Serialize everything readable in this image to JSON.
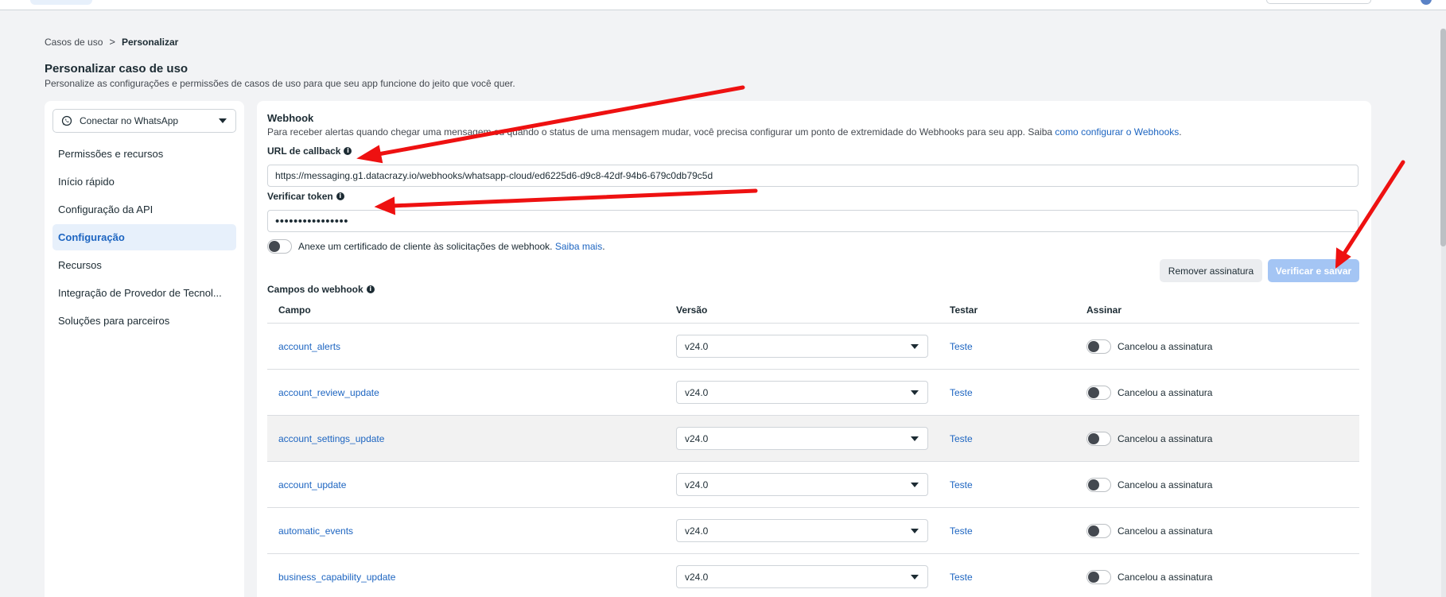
{
  "breadcrumb": {
    "parent": "Casos de uso",
    "separator": ">",
    "current": "Personalizar"
  },
  "header": {
    "title": "Personalizar caso de uso",
    "subtitle": "Personalize as configurações e permissões de casos de uso para que seu app funcione do jeito que você quer."
  },
  "sidebar": {
    "selector": {
      "label": "Conectar no WhatsApp",
      "icon": "whatsapp-icon"
    },
    "items": [
      {
        "label": "Permissões e recursos"
      },
      {
        "label": "Início rápido"
      },
      {
        "label": "Configuração da API"
      },
      {
        "label": "Configuração",
        "active": true
      },
      {
        "label": "Recursos"
      },
      {
        "label": "Integração de Provedor de Tecnol..."
      },
      {
        "label": "Soluções para parceiros"
      }
    ]
  },
  "webhook": {
    "title": "Webhook",
    "description": "Para receber alertas quando chegar uma mensagem ou quando o status de uma mensagem mudar, você precisa configurar um ponto de extremidade do Webhooks para seu app. Saiba",
    "description_link": "como configurar o Webhooks",
    "description_end": ".",
    "callback_label": "URL de callback",
    "callback_value": "https://messaging.g1.datacrazy.io/webhooks/whatsapp-cloud/ed6225d6-d9c8-42df-94b6-679c0db79c5d",
    "token_label": "Verificar token",
    "token_value": "••••••••••••••••",
    "cert_text": "Anexe um certificado de cliente às solicitações de webhook.",
    "cert_link": "Saiba mais",
    "cert_end": ".",
    "remove_button": "Remover assinatura",
    "verify_button": "Verificar e salvar"
  },
  "fields": {
    "title": "Campos do webhook",
    "headers": {
      "campo": "Campo",
      "versao": "Versão",
      "testar": "Testar",
      "assinar": "Assinar"
    },
    "rows": [
      {
        "campo": "account_alerts",
        "versao": "v24.0",
        "testar": "Teste",
        "assinar": "Cancelou a assinatura"
      },
      {
        "campo": "account_review_update",
        "versao": "v24.0",
        "testar": "Teste",
        "assinar": "Cancelou a assinatura"
      },
      {
        "campo": "account_settings_update",
        "versao": "v24.0",
        "testar": "Teste",
        "assinar": "Cancelou a assinatura"
      },
      {
        "campo": "account_update",
        "versao": "v24.0",
        "testar": "Teste",
        "assinar": "Cancelou a assinatura"
      },
      {
        "campo": "automatic_events",
        "versao": "v24.0",
        "testar": "Teste",
        "assinar": "Cancelou a assinatura"
      },
      {
        "campo": "business_capability_update",
        "versao": "v24.0",
        "testar": "Teste",
        "assinar": "Cancelou a assinatura"
      }
    ]
  },
  "colors": {
    "accent": "#1d65c1",
    "primary_button_disabled": "#a4c5f4",
    "annotation_arrow": "#ee1111",
    "active_nav_bg": "#e7f0fb"
  }
}
